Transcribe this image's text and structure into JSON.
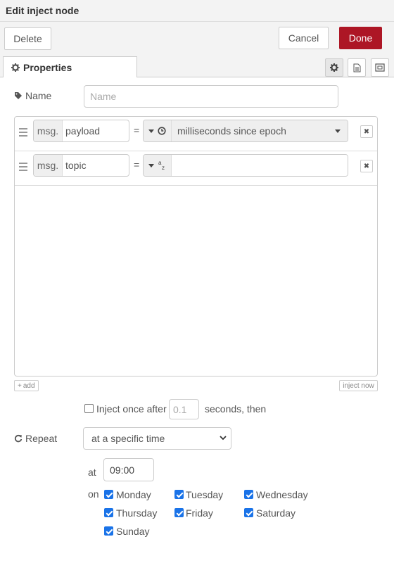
{
  "header": {
    "title": "Edit inject node"
  },
  "toolbar": {
    "delete_label": "Delete",
    "cancel_label": "Cancel",
    "done_label": "Done"
  },
  "tabs": {
    "properties_label": "Properties"
  },
  "form": {
    "name_label": "Name",
    "name_placeholder": "Name",
    "name_value": ""
  },
  "properties": [
    {
      "prefix": "msg.",
      "name": "payload",
      "equals": "=",
      "type_icon": "clock-icon",
      "value": "milliseconds since epoch"
    },
    {
      "prefix": "msg.",
      "name": "topic",
      "equals": "=",
      "type_icon": "string-az-icon",
      "value": ""
    }
  ],
  "list_buttons": {
    "add_label": "add",
    "inject_now_label": "inject now"
  },
  "inject_once": {
    "label": "Inject once after",
    "delay_placeholder": "0.1",
    "suffix": "seconds, then",
    "checked": false
  },
  "repeat": {
    "label": "Repeat",
    "selected": "at a specific time",
    "at_label": "at",
    "time_value": "09:00",
    "on_label": "on",
    "days": [
      {
        "label": "Monday",
        "checked": true
      },
      {
        "label": "Tuesday",
        "checked": true
      },
      {
        "label": "Wednesday",
        "checked": true
      },
      {
        "label": "Thursday",
        "checked": true
      },
      {
        "label": "Friday",
        "checked": true
      },
      {
        "label": "Saturday",
        "checked": true
      },
      {
        "label": "Sunday",
        "checked": true
      }
    ]
  },
  "colors": {
    "primary": "#ad1625",
    "checkbox": "#1a73e8"
  }
}
